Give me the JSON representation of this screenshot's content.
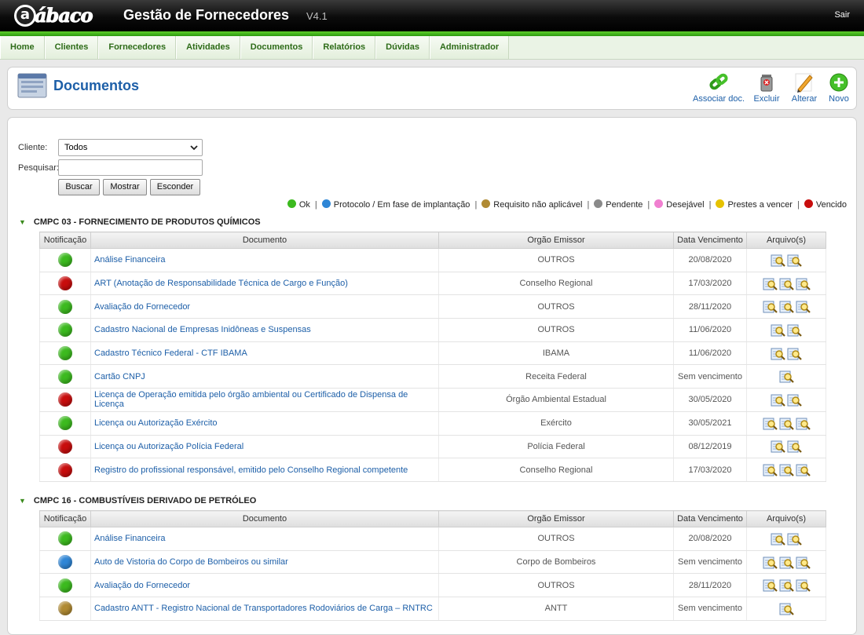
{
  "app": {
    "logo_mark": "a",
    "logo_text": "ábaco",
    "title": "Gestão de Fornecedores",
    "version": "V4.1",
    "logout": "Sair"
  },
  "nav": [
    "Home",
    "Clientes",
    "Fornecedores",
    "Atividades",
    "Documentos",
    "Relatórios",
    "Dúvidas",
    "Administrador"
  ],
  "page": {
    "title": "Documentos"
  },
  "actions": {
    "associate": "Associar doc.",
    "delete": "Excluir",
    "edit": "Alterar",
    "new": "Novo"
  },
  "filters": {
    "client_label": "Cliente:",
    "client_value": "Todos",
    "search_label": "Pesquisar:",
    "search_value": "",
    "buttons": {
      "search": "Buscar",
      "show": "Mostrar",
      "hide": "Esconder"
    }
  },
  "colors": {
    "ok": "#3cba1f",
    "protocol": "#2f86d6",
    "not_applicable": "#b08a33",
    "pending": "#8a8a8a",
    "desirable": "#f07fd0",
    "expiring": "#e6c200",
    "expired": "#c80d0d",
    "link": "#1d5fa8",
    "nav_text": "#2d6b18",
    "green_bar": "#3cb51a"
  },
  "legend": [
    {
      "status": "ok",
      "label": "Ok"
    },
    {
      "status": "protocol",
      "label": "Protocolo / Em fase de implantação"
    },
    {
      "status": "not_applicable",
      "label": "Requisito não aplicável"
    },
    {
      "status": "pending",
      "label": "Pendente"
    },
    {
      "status": "desirable",
      "label": "Desejável"
    },
    {
      "status": "expiring",
      "label": "Prestes a vencer"
    },
    {
      "status": "expired",
      "label": "Vencido"
    }
  ],
  "table_headers": {
    "notification": "Notificação",
    "document": "Documento",
    "issuer": "Orgão Emissor",
    "due_date": "Data Vencimento",
    "files": "Arquivo(s)"
  },
  "sections": [
    {
      "title": "CMPC 03 - FORNECIMENTO DE PRODUTOS QUÍMICOS",
      "rows": [
        {
          "status": "ok",
          "document": "Análise Financeira",
          "issuer": "OUTROS",
          "due_date": "20/08/2020",
          "files": 2
        },
        {
          "status": "expired",
          "document": "ART (Anotação de Responsabilidade Técnica de Cargo e Função)",
          "issuer": "Conselho Regional",
          "due_date": "17/03/2020",
          "files": 3
        },
        {
          "status": "ok",
          "document": "Avaliação do Fornecedor",
          "issuer": "OUTROS",
          "due_date": "28/11/2020",
          "files": 3
        },
        {
          "status": "ok",
          "document": "Cadastro Nacional de Empresas Inidôneas e Suspensas",
          "issuer": "OUTROS",
          "due_date": "11/06/2020",
          "files": 2
        },
        {
          "status": "ok",
          "document": "Cadastro Técnico Federal - CTF IBAMA",
          "issuer": "IBAMA",
          "due_date": "11/06/2020",
          "files": 2
        },
        {
          "status": "ok",
          "document": "Cartão CNPJ",
          "issuer": "Receita Federal",
          "due_date": "Sem vencimento",
          "files": 1
        },
        {
          "status": "expired",
          "document": "Licença de Operação emitida pelo órgão ambiental ou Certificado de Dispensa de Licença",
          "issuer": "Órgão Ambiental Estadual",
          "due_date": "30/05/2020",
          "files": 2
        },
        {
          "status": "ok",
          "document": "Licença ou Autorização Exército",
          "issuer": "Exército",
          "due_date": "30/05/2021",
          "files": 3
        },
        {
          "status": "expired",
          "document": "Licença ou Autorização Polícia Federal",
          "issuer": "Polícia Federal",
          "due_date": "08/12/2019",
          "files": 2
        },
        {
          "status": "expired",
          "document": "Registro do profissional responsável, emitido pelo Conselho Regional competente",
          "issuer": "Conselho Regional",
          "due_date": "17/03/2020",
          "files": 3
        }
      ]
    },
    {
      "title": "CMPC 16 - COMBUSTÍVEIS DERIVADO DE PETRÓLEO",
      "rows": [
        {
          "status": "ok",
          "document": "Análise Financeira",
          "issuer": "OUTROS",
          "due_date": "20/08/2020",
          "files": 2
        },
        {
          "status": "protocol",
          "document": "Auto de Vistoria do Corpo de Bombeiros ou similar",
          "issuer": "Corpo de Bombeiros",
          "due_date": "Sem vencimento",
          "files": 3
        },
        {
          "status": "ok",
          "document": "Avaliação do Fornecedor",
          "issuer": "OUTROS",
          "due_date": "28/11/2020",
          "files": 3
        },
        {
          "status": "not_applicable",
          "document": "Cadastro ANTT - Registro Nacional de Transportadores Rodoviários de Carga – RNTRC",
          "issuer": "ANTT",
          "due_date": "Sem vencimento",
          "files": 1
        }
      ]
    }
  ]
}
